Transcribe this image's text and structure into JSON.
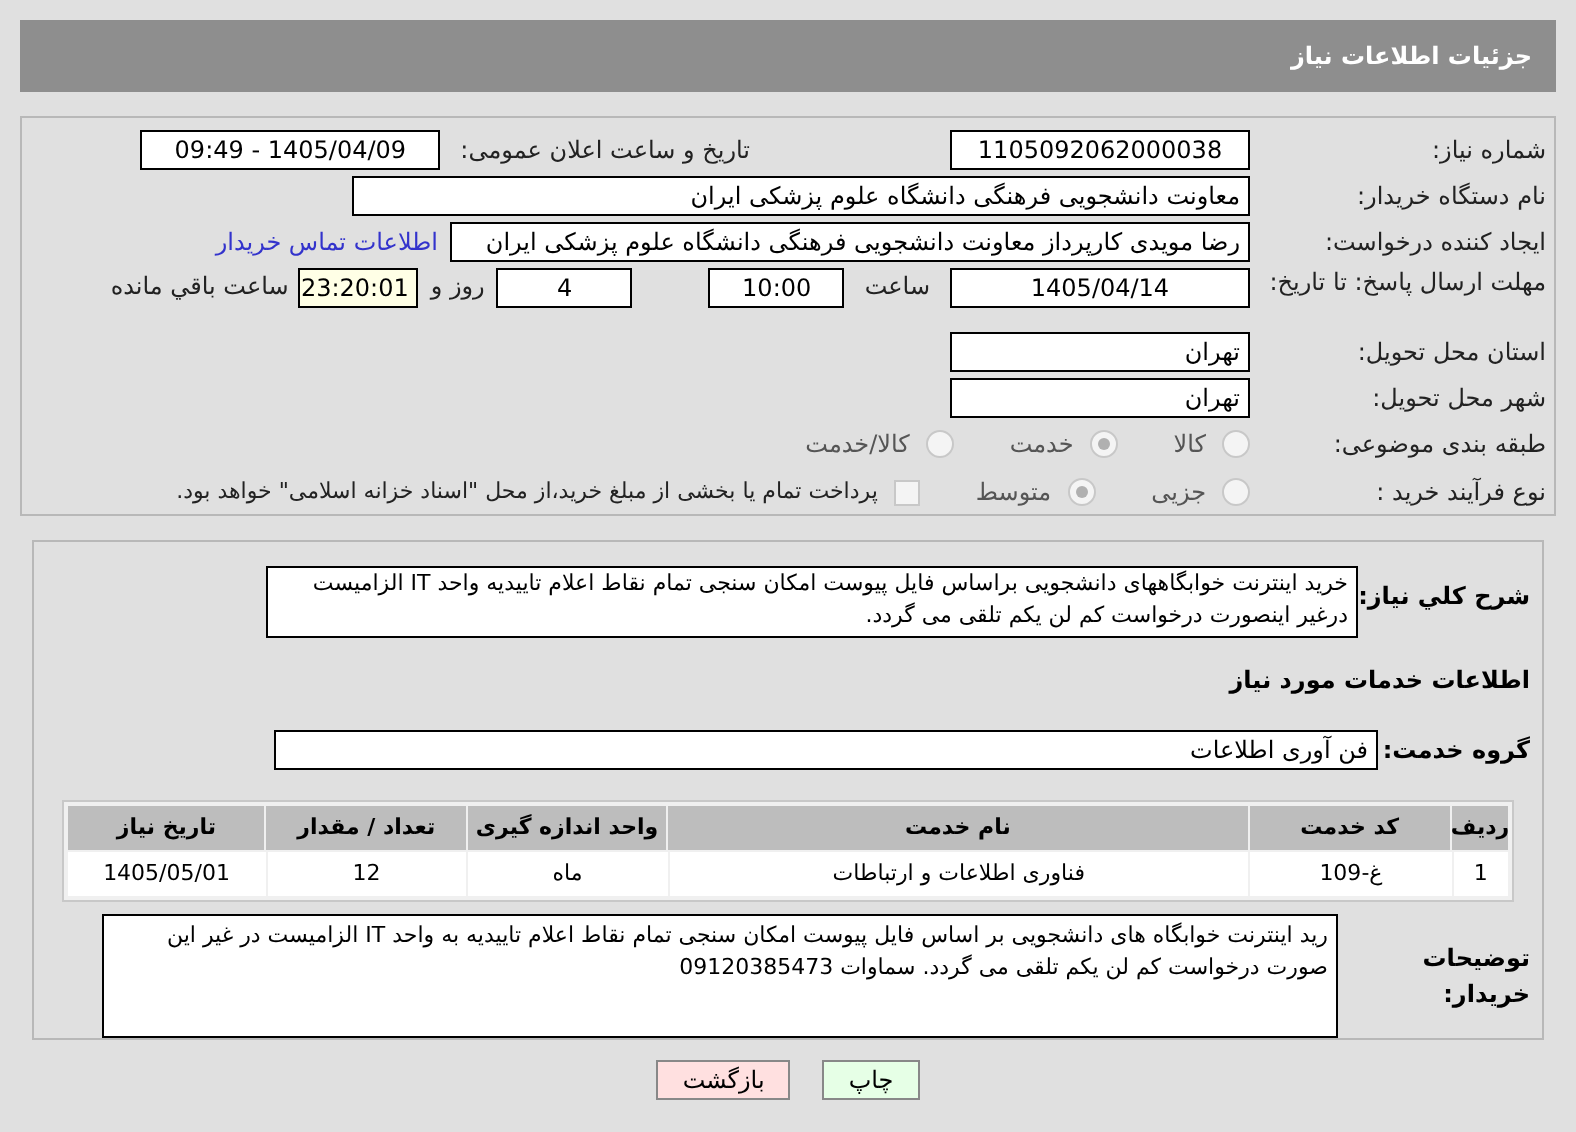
{
  "header": {
    "title": "جزئیات اطلاعات نیاز"
  },
  "need_number": {
    "label": "شماره نیاز:",
    "value": "1105092062000038"
  },
  "announce": {
    "label": "تاریخ و ساعت اعلان عمومی:",
    "value": "1405/04/09 - 09:49"
  },
  "buyer": {
    "label": "نام دستگاه خریدار:",
    "value": "معاونت دانشجویی  فرهنگی دانشگاه علوم پزشکی ایران"
  },
  "creator": {
    "label": "ایجاد کننده درخواست:",
    "value": "رضا  مویدی  کارپرداز معاونت دانشجویی  فرهنگی دانشگاه علوم پزشکی ایران",
    "link": "اطلاعات تماس خریدار"
  },
  "deadline": {
    "label": "مهلت ارسال پاسخ: تا تاریخ:",
    "date": "1405/04/14",
    "time_label": "ساعت",
    "time": "10:00",
    "days": "4",
    "days_label": "روز و",
    "remaining": "23:20:01",
    "remaining_label": "ساعت باقي مانده"
  },
  "province": {
    "label": "استان محل تحویل:",
    "value": "تهران"
  },
  "city": {
    "label": "شهر محل تحویل:",
    "value": "تهران"
  },
  "category": {
    "label": "طبقه بندی موضوعی:",
    "options": [
      {
        "label": "کالا",
        "selected": false
      },
      {
        "label": "خدمت",
        "selected": true
      },
      {
        "label": "کالا/خدمت",
        "selected": false
      }
    ]
  },
  "process": {
    "label": "نوع فرآیند خرید :",
    "options": [
      {
        "label": "جزیی",
        "selected": false
      },
      {
        "label": "متوسط",
        "selected": true
      }
    ],
    "treasury": {
      "label": "پرداخت تمام یا بخشی از مبلغ خرید،از محل \"اسناد خزانه اسلامی\" خواهد بود.",
      "checked": false
    }
  },
  "description": {
    "label": "شرح کلي نیاز:",
    "value": "خرید اینترنت خوابگاههای دانشجویی براساس فایل پیوست امکان سنجی تمام نقاط اعلام تاییدیه واحد IT الزامیست درغیر اینصورت درخواست کم لن یکم تلقی می گردد."
  },
  "services_heading": "اطلاعات خدمات مورد نیاز",
  "service_group": {
    "label": "گروه خدمت:",
    "value": "فن آوری اطلاعات"
  },
  "table": {
    "columns": [
      "ردیف",
      "کد خدمت",
      "نام خدمت",
      "واحد اندازه گیری",
      "تعداد / مقدار",
      "تاریخ نیاز"
    ],
    "rows": [
      [
        "1",
        "غ-109",
        "فناوری اطلاعات و ارتباطات",
        "ماه",
        "12",
        "1405/05/01"
      ]
    ]
  },
  "buyer_notes": {
    "label": "توضیحات خریدار:",
    "value": "رید اینترنت خوابگاه های دانشجویی بر اساس فایل پیوست امکان سنجی تمام نقاط اعلام تاییدیه به واحد IT الزامیست در غیر این صورت درخواست کم لن یکم تلقی می گردد. سماوات 09120385473"
  },
  "buttons": [
    {
      "label": "چاپ",
      "kind": "print"
    },
    {
      "label": "بازگشت",
      "kind": "back"
    }
  ]
}
